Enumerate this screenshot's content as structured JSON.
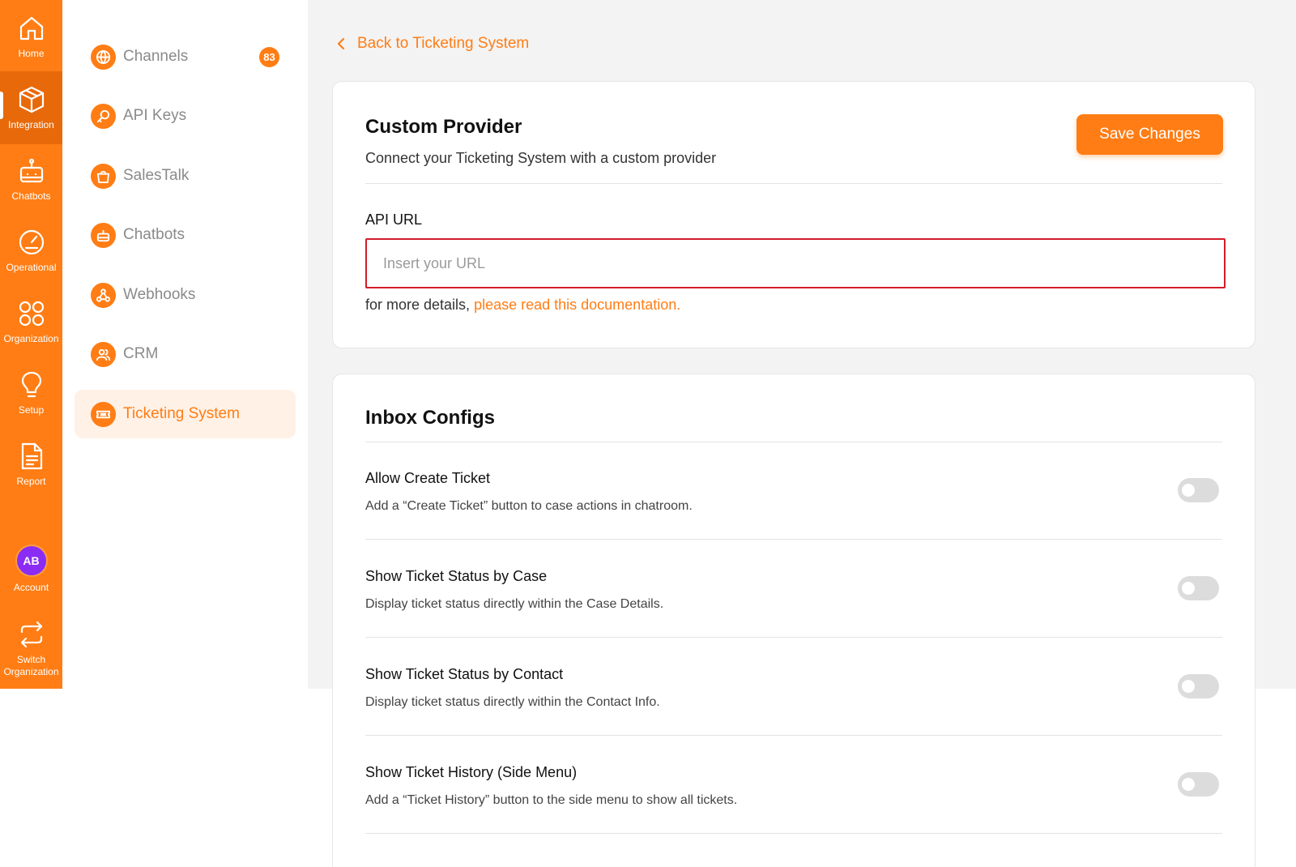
{
  "rail": {
    "items": [
      {
        "label": "Home",
        "icon": "home-icon"
      },
      {
        "label": "Integration",
        "icon": "cube-icon",
        "active": true
      },
      {
        "label": "Chatbots",
        "icon": "robot-icon"
      },
      {
        "label": "Operational",
        "icon": "gauge-icon"
      },
      {
        "label": "Organization",
        "icon": "four-circles-icon"
      },
      {
        "label": "Setup",
        "icon": "lightbulb-icon"
      },
      {
        "label": "Report",
        "icon": "document-icon"
      }
    ],
    "account": {
      "initials": "AB",
      "label": "Account"
    },
    "switch": {
      "label_line1": "Switch",
      "label_line2": "Organization",
      "icon": "switch-arrows-icon"
    }
  },
  "subnav": {
    "items": [
      {
        "label": "Channels",
        "icon": "globe-icon",
        "badge": "83"
      },
      {
        "label": "API Keys",
        "icon": "key-icon"
      },
      {
        "label": "SalesTalk",
        "icon": "shopping-bag-icon"
      },
      {
        "label": "Chatbots",
        "icon": "robot-icon"
      },
      {
        "label": "Webhooks",
        "icon": "webhook-icon"
      },
      {
        "label": "CRM",
        "icon": "users-icon"
      },
      {
        "label": "Ticketing System",
        "icon": "ticket-icon",
        "active": true
      }
    ]
  },
  "main": {
    "back_label": "Back to Ticketing System",
    "provider_card": {
      "title": "Custom Provider",
      "subtitle": "Connect your Ticketing System with a custom provider",
      "save_label": "Save Changes",
      "api_url_label": "API URL",
      "api_url_placeholder": "Insert your URL",
      "api_url_value": "",
      "help_prefix": "for more details, ",
      "help_link": "please read this documentation."
    },
    "inbox_card": {
      "title": "Inbox Configs",
      "settings": [
        {
          "title": "Allow Create Ticket",
          "desc": "Add a “Create Ticket” button to case actions in chatroom.",
          "enabled": false
        },
        {
          "title": "Show Ticket Status by Case",
          "desc": "Display ticket status directly within the Case Details.",
          "enabled": false
        },
        {
          "title": "Show Ticket Status by Contact",
          "desc": "Display ticket status directly within the Contact Info.",
          "enabled": false
        },
        {
          "title": "Show Ticket History (Side Menu)",
          "desc": "Add a “Ticket History” button to the side menu to show all tickets.",
          "enabled": false
        }
      ]
    }
  },
  "colors": {
    "accent": "#ff7d14",
    "avatar": "#8b2cf5",
    "input_error_border": "#d21c2a"
  }
}
